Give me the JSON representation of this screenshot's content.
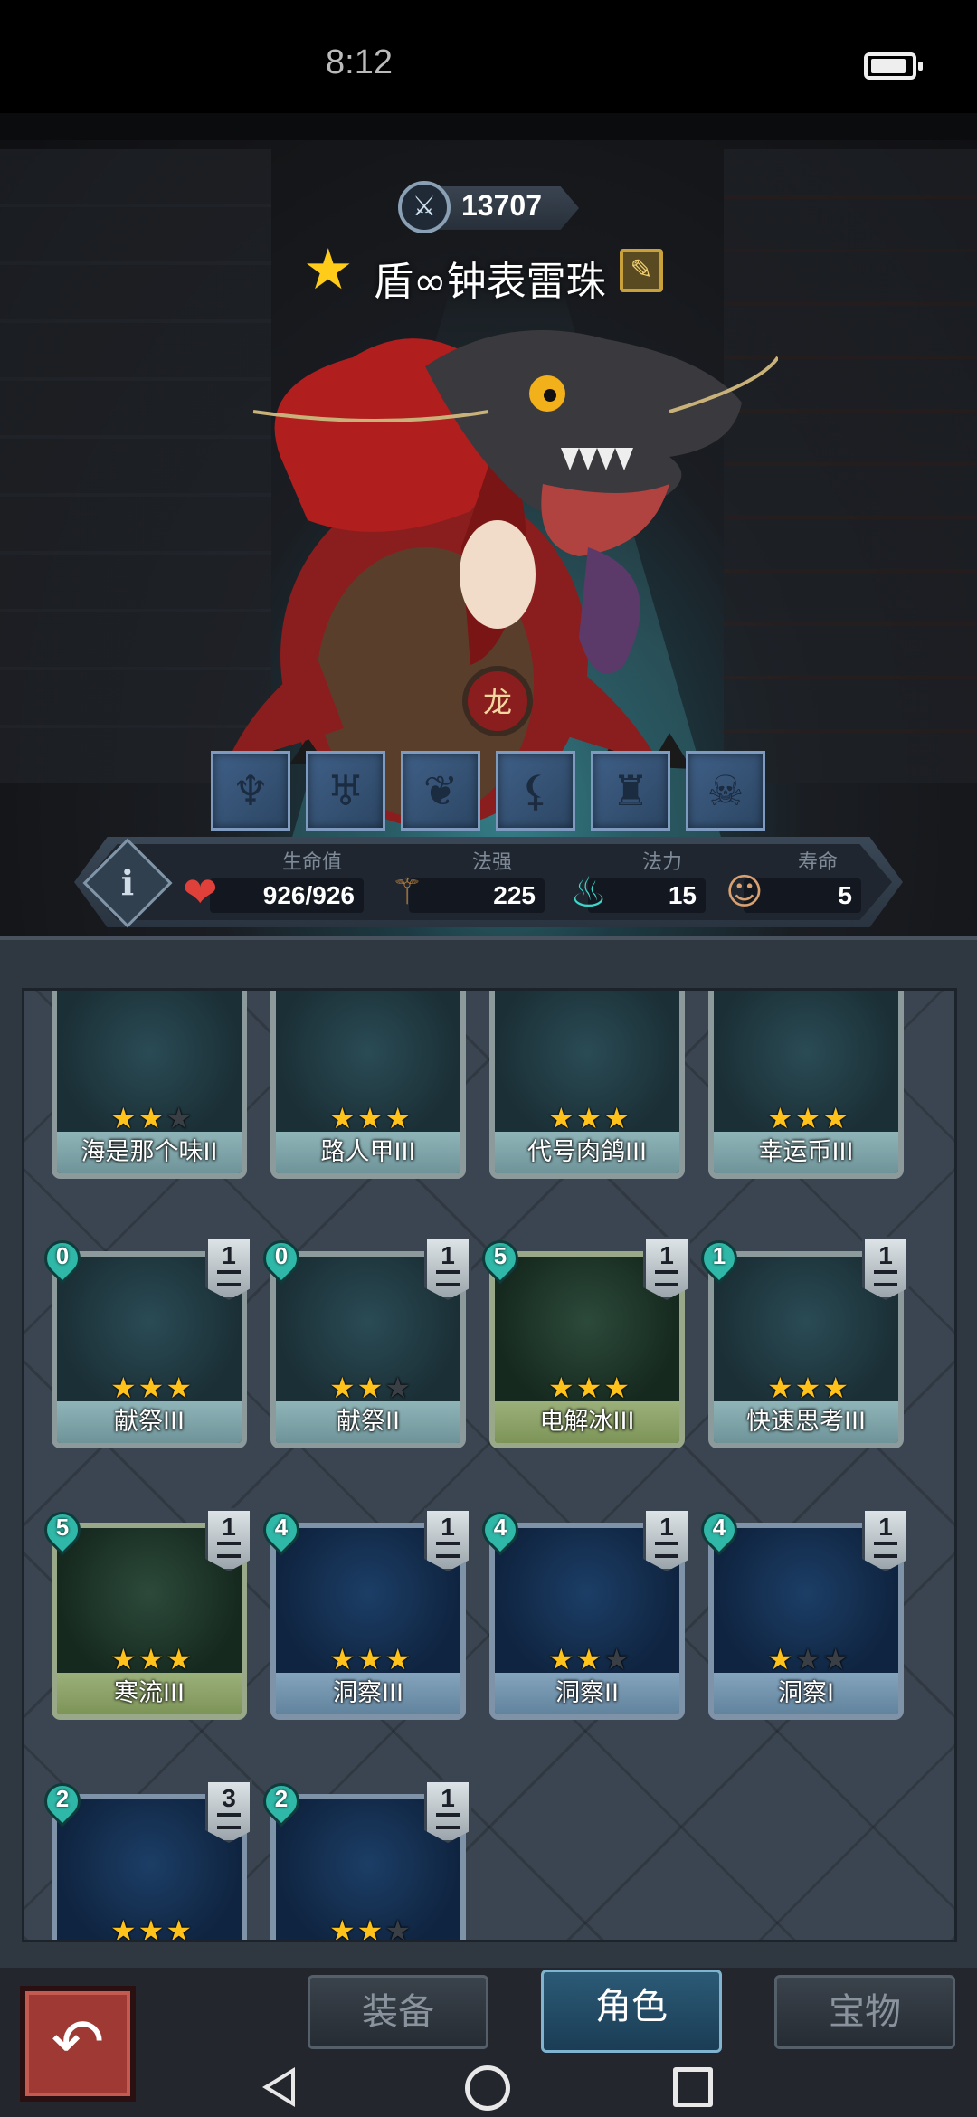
{
  "status_bar": {
    "time": "8:12"
  },
  "hero": {
    "power": "13707",
    "name": "盾∞钟表雷珠",
    "traits": [
      "dragon-icon",
      "muscle-icon",
      "wing-icon",
      "claw-icon",
      "tower-icon",
      "skull-icon"
    ]
  },
  "stats": {
    "hp_label": "生命值",
    "hp_value": "926/926",
    "spell_label": "法强",
    "spell_value": "225",
    "mana_label": "法力",
    "mana_value": "15",
    "life_label": "寿命",
    "life_value": "5"
  },
  "cards": [
    {
      "name": "海是那个味II",
      "stars": 2,
      "max_stars": 3,
      "style": "plain"
    },
    {
      "name": "路人甲III",
      "stars": 3,
      "max_stars": 3,
      "style": "plain"
    },
    {
      "name": "代号肉鸽III",
      "stars": 3,
      "max_stars": 3,
      "style": "plain"
    },
    {
      "name": "幸运币III",
      "stars": 3,
      "max_stars": 3,
      "style": "plain"
    },
    {
      "name": "献祭III",
      "cost": "0",
      "count": "1",
      "stars": 3,
      "max_stars": 3,
      "style": "plain"
    },
    {
      "name": "献祭II",
      "cost": "0",
      "count": "1",
      "stars": 2,
      "max_stars": 3,
      "style": "plain"
    },
    {
      "name": "电解冰III",
      "cost": "5",
      "count": "1",
      "stars": 3,
      "max_stars": 3,
      "style": "green"
    },
    {
      "name": "快速思考III",
      "cost": "1",
      "count": "1",
      "stars": 3,
      "max_stars": 3,
      "style": "plain"
    },
    {
      "name": "寒流III",
      "cost": "5",
      "count": "1",
      "stars": 3,
      "max_stars": 3,
      "style": "green"
    },
    {
      "name": "洞察III",
      "cost": "4",
      "count": "1",
      "stars": 3,
      "max_stars": 3,
      "style": "blue"
    },
    {
      "name": "洞察II",
      "cost": "4",
      "count": "1",
      "stars": 2,
      "max_stars": 3,
      "style": "blue"
    },
    {
      "name": "洞察I",
      "cost": "4",
      "count": "1",
      "stars": 1,
      "max_stars": 3,
      "style": "blue"
    },
    {
      "name": "",
      "cost": "2",
      "count": "3",
      "stars": 3,
      "max_stars": 3,
      "style": "blue"
    },
    {
      "name": "",
      "cost": "2",
      "count": "1",
      "stars": 2,
      "max_stars": 3,
      "style": "blue"
    }
  ],
  "tabs": {
    "equipment": "装备",
    "character": "角色",
    "treasure": "宝物"
  }
}
